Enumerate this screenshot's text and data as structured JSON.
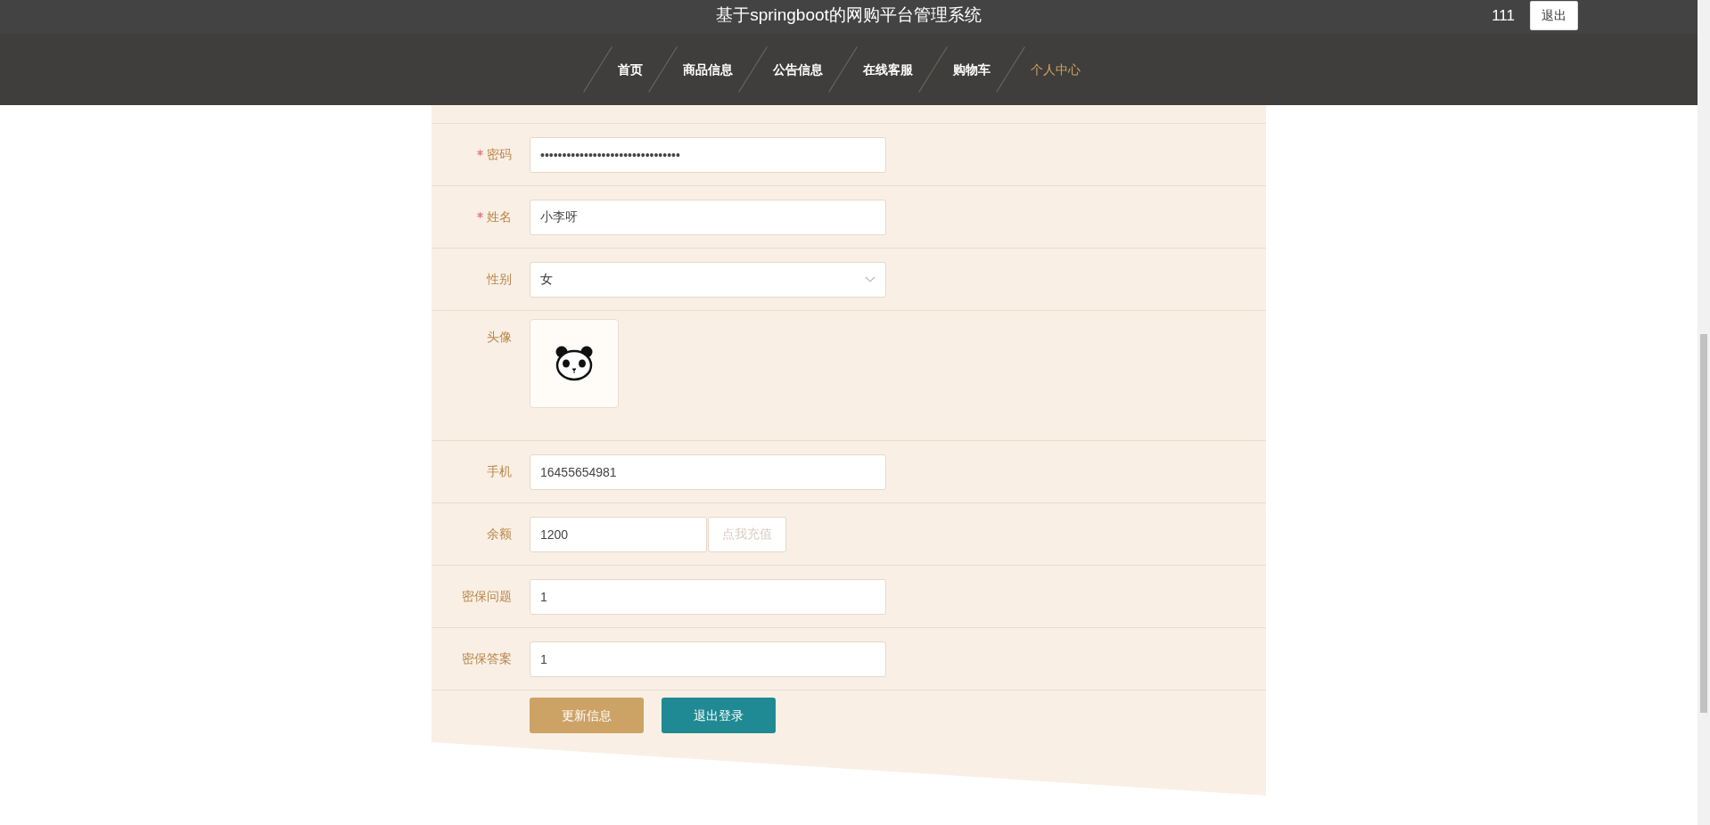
{
  "header": {
    "title": "基于springboot的网购平台管理系统",
    "user": "111",
    "logout": "退出"
  },
  "nav": [
    {
      "label": "首页",
      "selected": false
    },
    {
      "label": "商品信息",
      "selected": false
    },
    {
      "label": "公告信息",
      "selected": false
    },
    {
      "label": "在线客服",
      "selected": false
    },
    {
      "label": "购物车",
      "selected": false
    },
    {
      "label": "个人中心",
      "selected": true
    }
  ],
  "form": {
    "fields": [
      {
        "kind": "text",
        "label": "密码",
        "required": true,
        "value": "••••••••••••••••••••••••••••••••"
      },
      {
        "kind": "text",
        "label": "姓名",
        "required": true,
        "value": "小李呀"
      },
      {
        "kind": "select",
        "label": "性别",
        "required": false,
        "value": "女"
      },
      {
        "kind": "image",
        "label": "头像",
        "required": false
      },
      {
        "kind": "text",
        "label": "手机",
        "required": false,
        "value": "16455654981"
      },
      {
        "kind": "balance",
        "label": "余额",
        "required": false,
        "value": "1200",
        "action": "点我充值"
      },
      {
        "kind": "text",
        "label": "密保问题",
        "required": false,
        "value": "1"
      },
      {
        "kind": "text",
        "label": "密保答案",
        "required": false,
        "value": "1"
      }
    ],
    "buttons": [
      {
        "kind": "primary",
        "label": "更新信息"
      },
      {
        "kind": "secondary",
        "label": "退出登录"
      }
    ]
  }
}
